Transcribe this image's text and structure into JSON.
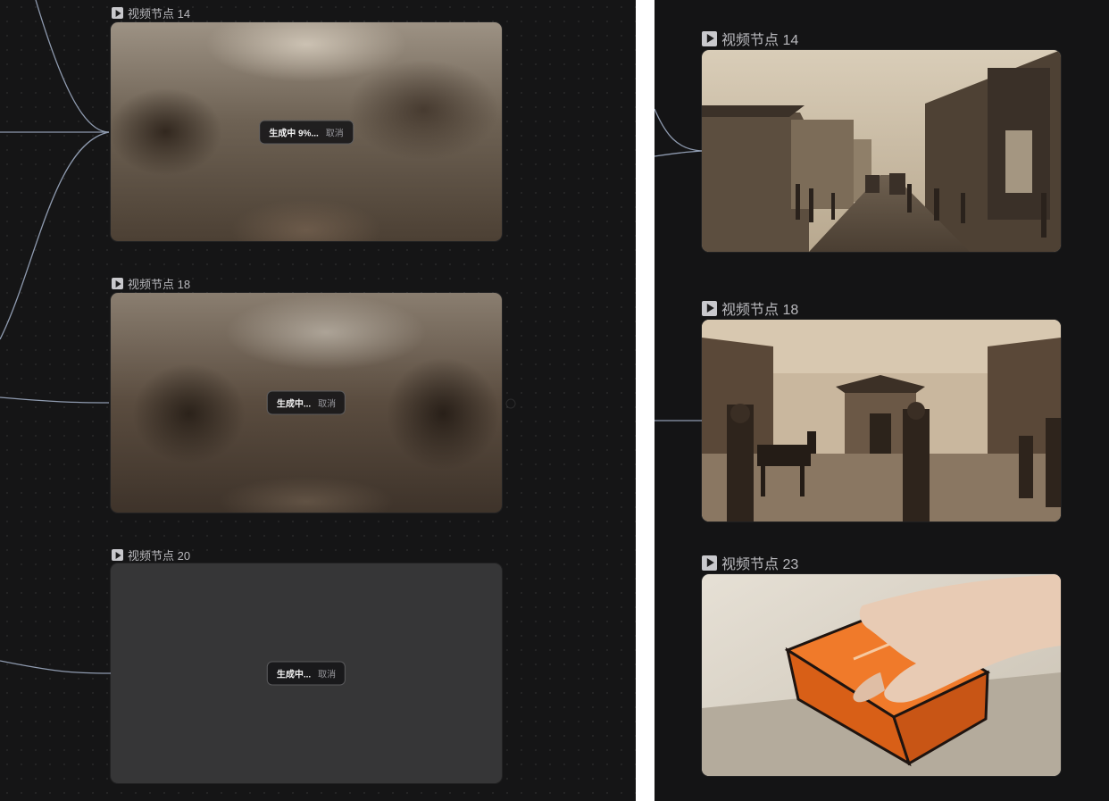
{
  "left_panel": {
    "nodes": [
      {
        "title": "视频节点 14",
        "status": "生成中 9%...",
        "cancel": "取消"
      },
      {
        "title": "视频节点 18",
        "status": "生成中...",
        "cancel": "取消"
      },
      {
        "title": "视频节点 20",
        "status": "生成中...",
        "cancel": "取消"
      }
    ]
  },
  "right_panel": {
    "nodes": [
      {
        "title": "视频节点 14"
      },
      {
        "title": "视频节点 18"
      },
      {
        "title": "视频节点 23"
      }
    ]
  },
  "colors": {
    "canvas_bg": "#151516",
    "wire": "#8f9bb0",
    "empty_card": "#363637",
    "box_orange": "#e8661e"
  },
  "icons": [
    "play-icon"
  ]
}
